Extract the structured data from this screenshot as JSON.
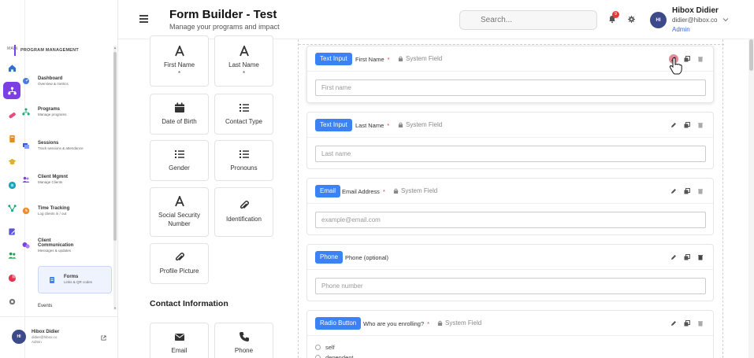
{
  "header": {
    "title": "Form Builder - Test",
    "subtitle": "Manage your programs and impact",
    "search_placeholder": "Search...",
    "notification_count": "9",
    "user": {
      "initials": "HI",
      "name": "Hibox Didier",
      "email": "didier@hibox.co",
      "role": "Admin"
    }
  },
  "rail": {
    "label": "MAIN"
  },
  "sidebar": {
    "section": "PROGRAM MANAGEMENT",
    "items": [
      {
        "label": "Dashboard",
        "desc": "Overview & metrics"
      },
      {
        "label": "Programs",
        "desc": "Manage programs"
      },
      {
        "label": "Sessions",
        "desc": "Track sessions & attendance"
      },
      {
        "label": "Client Mgmnt",
        "desc": "Manage Clients"
      },
      {
        "label": "Time Tracking",
        "desc": "Log clients in / out"
      },
      {
        "label": "Client Communication",
        "desc": "Messages & updates"
      },
      {
        "label": "Forms",
        "desc": "Links & QR codes"
      },
      {
        "label": "Events",
        "desc": ""
      }
    ],
    "user": {
      "initials": "HI",
      "name": "Hibox Didier",
      "email": "didier@hibox.co",
      "role": "Admin"
    }
  },
  "palette": {
    "fields": [
      {
        "label": "First Name",
        "mark": "*"
      },
      {
        "label": "Last Name",
        "mark": "*"
      },
      {
        "label": "Date of Birth"
      },
      {
        "label": "Contact Type"
      },
      {
        "label": "Gender"
      },
      {
        "label": "Pronouns"
      },
      {
        "label": "Social Security Number"
      },
      {
        "label": "Identification"
      },
      {
        "label": "Profile Picture"
      }
    ],
    "contact_heading": "Contact Information",
    "contact_fields": [
      {
        "label": "Email"
      },
      {
        "label": "Phone"
      }
    ]
  },
  "form": {
    "fields": [
      {
        "type": "Text Input",
        "label": "First Name",
        "required": "*",
        "system": "System Field",
        "placeholder": "First name"
      },
      {
        "type": "Text Input",
        "label": "Last Name",
        "required": "*",
        "system": "System Field",
        "placeholder": "Last name"
      },
      {
        "type": "Email",
        "label": "Email Address",
        "required": "*",
        "system": "System Field",
        "placeholder": "example@email.com"
      },
      {
        "type": "Phone",
        "label": "Phone (optional)",
        "placeholder": "Phone number"
      },
      {
        "type": "Radio Button",
        "label": "Who are you enrolling?",
        "required": "*",
        "system": "System Field",
        "options": [
          "self",
          "dependent"
        ]
      }
    ]
  },
  "colors": {
    "accent": "#7b3fe4",
    "tag": "#3b82f6",
    "required": "#e53935"
  }
}
